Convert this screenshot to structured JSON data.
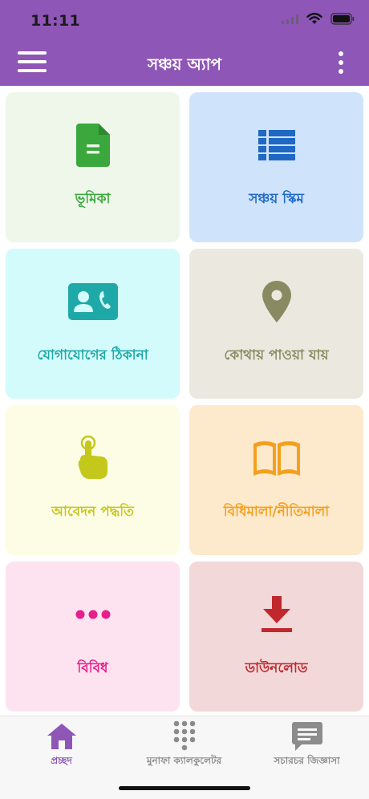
{
  "status_bar": {
    "time": "11:11"
  },
  "header": {
    "title": "সঞ্চয় অ্যাপ",
    "background": "#8e56b7"
  },
  "tiles": [
    {
      "label": "ভূমিকা",
      "icon": "document-icon",
      "color": "#3aa83c"
    },
    {
      "label": "সঞ্চয় স্কিম",
      "icon": "list-icon",
      "color": "#1f68c4"
    },
    {
      "label": "যোগাযোগের ঠিকানা",
      "icon": "contact-card-icon",
      "color": "#1ea9a8"
    },
    {
      "label": "কোথায় পাওয়া যায়",
      "icon": "location-pin-icon",
      "color": "#8a8a62"
    },
    {
      "label": "আবেদন পদ্ধতি",
      "icon": "pointing-hand-icon",
      "color": "#c4c81a"
    },
    {
      "label": "বিধিমালা/নীতিমালা",
      "icon": "open-book-icon",
      "color": "#f4a01d"
    },
    {
      "label": "বিবিধ",
      "icon": "ellipsis-icon",
      "color": "#e81e8a"
    },
    {
      "label": "ডাউনলোড",
      "icon": "download-icon",
      "color": "#c0282e"
    }
  ],
  "tabbar": {
    "items": [
      {
        "label": "প্রচ্ছদ",
        "icon": "home-icon",
        "active": true
      },
      {
        "label": "মুনাফা ক্যালকুলেটর",
        "icon": "keypad-icon",
        "active": false
      },
      {
        "label": "সচারচর জিজ্ঞাসা",
        "icon": "chat-icon",
        "active": false
      }
    ],
    "active_color": "#8e56b7",
    "inactive_color": "#8c8c8c"
  }
}
